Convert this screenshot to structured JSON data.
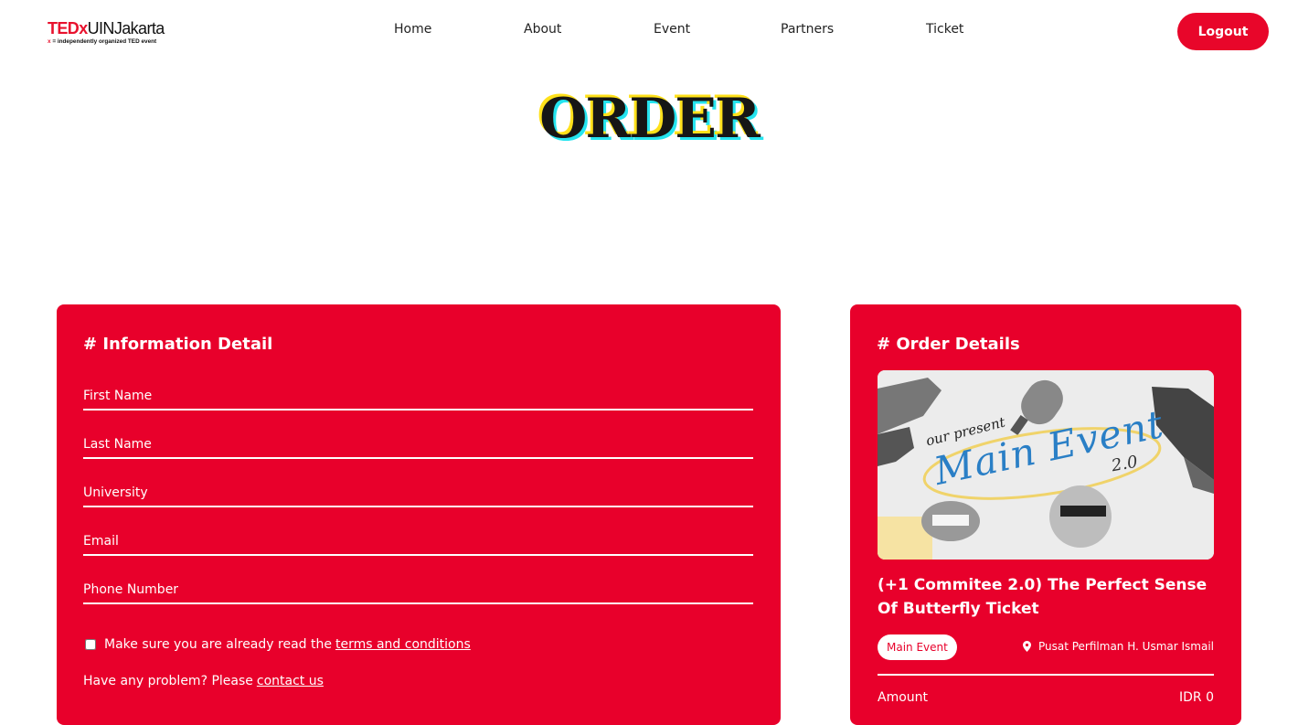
{
  "brand": {
    "logo_ted": "TED",
    "logo_x": "x",
    "logo_name": "UINJakarta",
    "logo_tagline_x": "x",
    "logo_tagline": "= independently organized TED event"
  },
  "nav": {
    "items": [
      {
        "label": "Home"
      },
      {
        "label": "About"
      },
      {
        "label": "Event"
      },
      {
        "label": "Partners"
      },
      {
        "label": "Ticket"
      }
    ],
    "logout_label": "Logout"
  },
  "page": {
    "title": "ORDER"
  },
  "info_card": {
    "heading": "# Information Detail",
    "fields": [
      {
        "placeholder": "First Name",
        "value": ""
      },
      {
        "placeholder": "Last Name",
        "value": ""
      },
      {
        "placeholder": "University",
        "value": ""
      },
      {
        "placeholder": "Email",
        "value": ""
      },
      {
        "placeholder": "Phone Number",
        "value": ""
      }
    ],
    "terms_text": "Make sure you are already read the",
    "terms_link": "terms and conditions",
    "terms_checked": false,
    "help_text": "Have any problem? Please",
    "help_link": "contact us"
  },
  "order_card": {
    "heading": "# Order Details",
    "image": {
      "script_small": "our present",
      "script_main": "Main Event",
      "script_version": "2.0"
    },
    "event_title": "(+1 Commitee 2.0) The Perfect Sense Of Butterfly Ticket",
    "category": "Main Event",
    "location": "Pusat Perfilman H. Usmar Ismail",
    "amount_label": "Amount",
    "amount_value": "IDR 0"
  },
  "colors": {
    "brand_red": "#e8002b",
    "logout_red": "#e8062a",
    "title_yellow": "#ffe11a",
    "title_cyan": "#25e4ef"
  }
}
